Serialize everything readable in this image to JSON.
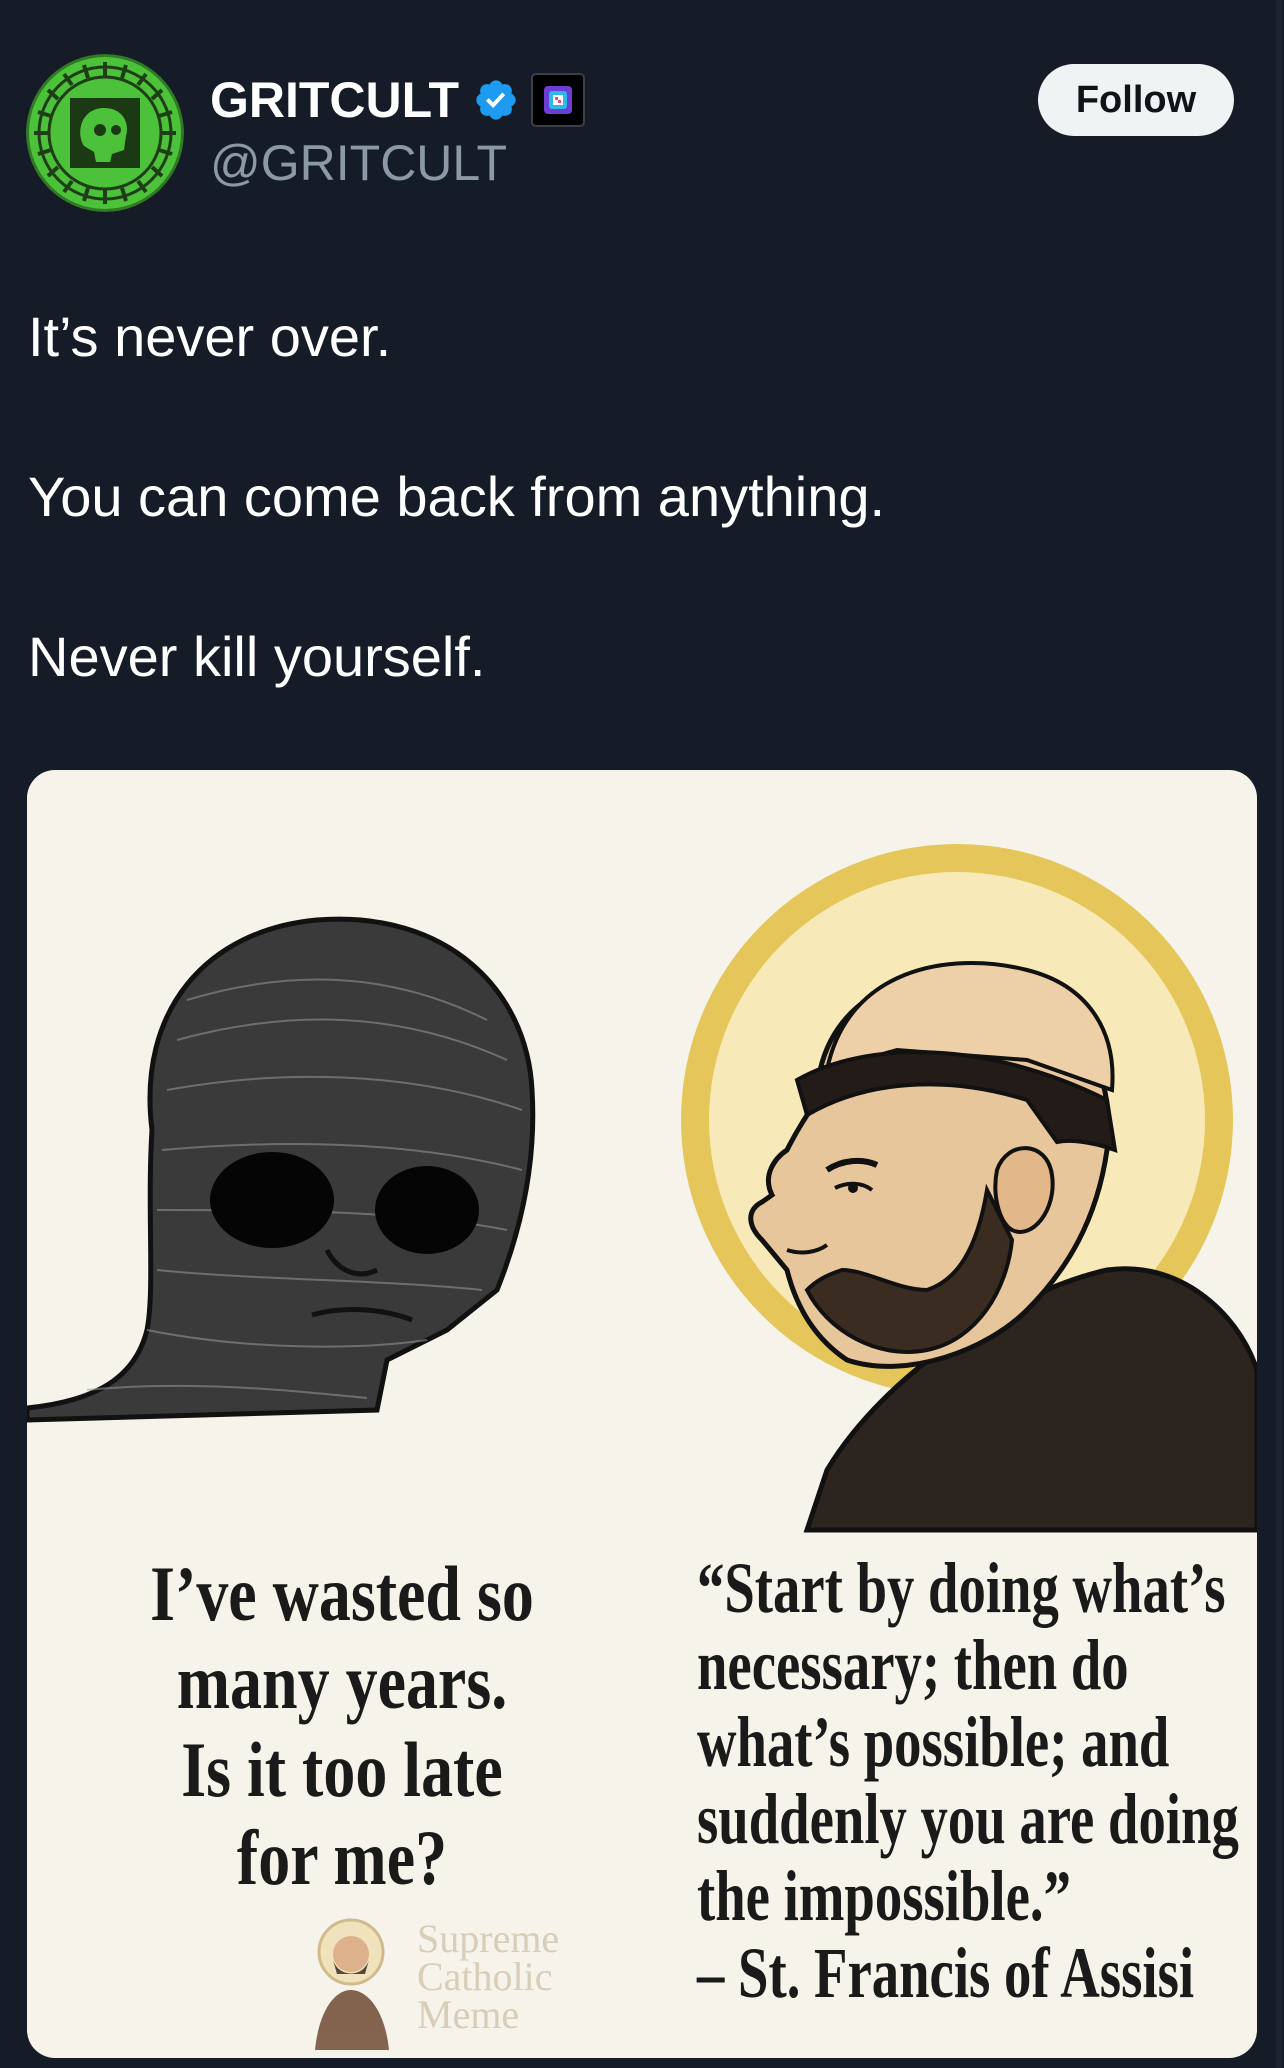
{
  "profile": {
    "display_name": "GRITCULT",
    "handle": "@GRITCULT",
    "verified_icon": "verified-badge-icon",
    "affiliate_icon": "affiliate-badge-icon"
  },
  "actions": {
    "follow_label": "Follow"
  },
  "tweet": {
    "lines": [
      "It’s never over.",
      "You can come back from anything.",
      "Never kill yourself."
    ]
  },
  "media": {
    "left_caption": [
      "I’ve wasted so",
      "many years.",
      "Is it too late",
      "for me?"
    ],
    "right_caption": [
      "“Start by doing what’s",
      "necessary; then do",
      "what’s possible; and",
      "suddenly you are doing",
      "the impossible.”",
      "– St. Francis of Assisi"
    ],
    "watermark": [
      "Supreme",
      "Catholic",
      "Meme"
    ]
  },
  "colors": {
    "background": "#151c27",
    "avatar_green": "#4cc13a",
    "verified_blue": "#1d9bf0",
    "halo_gold": "#e5c65a",
    "image_bg": "#f6f3ea"
  }
}
